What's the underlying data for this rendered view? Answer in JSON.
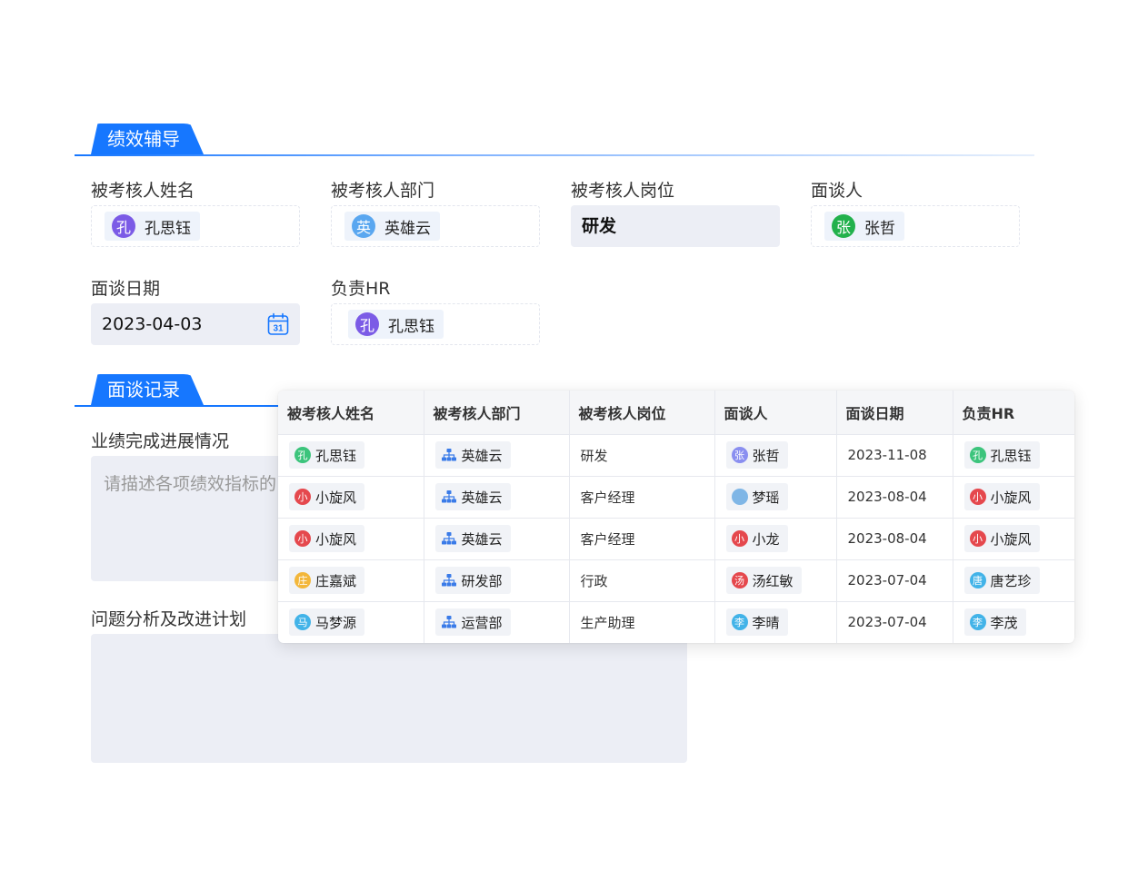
{
  "section1": {
    "title": "绩效辅导"
  },
  "section2": {
    "title": "面谈记录"
  },
  "form": {
    "name_label": "被考核人姓名",
    "name_value": "孔思钰",
    "name_avatar": "孔",
    "dept_label": "被考核人部门",
    "dept_value": "英雄云",
    "dept_avatar": "英",
    "post_label": "被考核人岗位",
    "post_value": "研发",
    "interviewer_label": "面谈人",
    "interviewer_value": "张哲",
    "interviewer_avatar": "张",
    "date_label": "面谈日期",
    "date_value": "2023-04-03",
    "calendar_day": "31",
    "hr_label": "负责HR",
    "hr_value": "孔思钰",
    "hr_avatar": "孔",
    "progress_label": "业绩完成进展情况",
    "progress_placeholder": "请描述各项绩效指标的",
    "plan_label": "问题分析及改进计划"
  },
  "table": {
    "headers": [
      "被考核人姓名",
      "被考核人部门",
      "被考核人岗位",
      "面谈人",
      "面谈日期",
      "负责HR"
    ],
    "rows": [
      {
        "name": "孔思钰",
        "name_av": "孔",
        "name_color": "#3cc47c",
        "dept": "英雄云",
        "post": "研发",
        "iv": "张哲",
        "iv_av": "张",
        "iv_color": "#8a8ff0",
        "date": "2023-11-08",
        "hr": "孔思钰",
        "hr_av": "孔",
        "hr_color": "#3cc47c"
      },
      {
        "name": "小旋风",
        "name_av": "小",
        "name_color": "#e5484d",
        "dept": "英雄云",
        "post": "客户经理",
        "iv": "梦瑶",
        "iv_av": "",
        "iv_color": "#7fb6e6",
        "date": "2023-08-04",
        "hr": "小旋风",
        "hr_av": "小",
        "hr_color": "#e5484d"
      },
      {
        "name": "小旋风",
        "name_av": "小",
        "name_color": "#e5484d",
        "dept": "英雄云",
        "post": "客户经理",
        "iv": "小龙",
        "iv_av": "小",
        "iv_color": "#e5484d",
        "date": "2023-08-04",
        "hr": "小旋风",
        "hr_av": "小",
        "hr_color": "#e5484d"
      },
      {
        "name": "庄嘉斌",
        "name_av": "庄",
        "name_color": "#f3b73b",
        "dept": "研发部",
        "post": "行政",
        "iv": "汤红敏",
        "iv_av": "汤",
        "iv_color": "#e5484d",
        "date": "2023-07-04",
        "hr": "唐艺珍",
        "hr_av": "唐",
        "hr_color": "#42b3e8"
      },
      {
        "name": "马梦源",
        "name_av": "马",
        "name_color": "#42b3e8",
        "dept": "运营部",
        "post": "生产助理",
        "iv": "李晴",
        "iv_av": "李",
        "iv_color": "#42b3e8",
        "date": "2023-07-04",
        "hr": "李茂",
        "hr_av": "李",
        "hr_color": "#42b3e8"
      }
    ]
  },
  "colors": {
    "accent": "#1677ff",
    "avatar_purple": "#7b5be6",
    "avatar_blue": "#5aa7f0",
    "avatar_green": "#22b14c"
  }
}
